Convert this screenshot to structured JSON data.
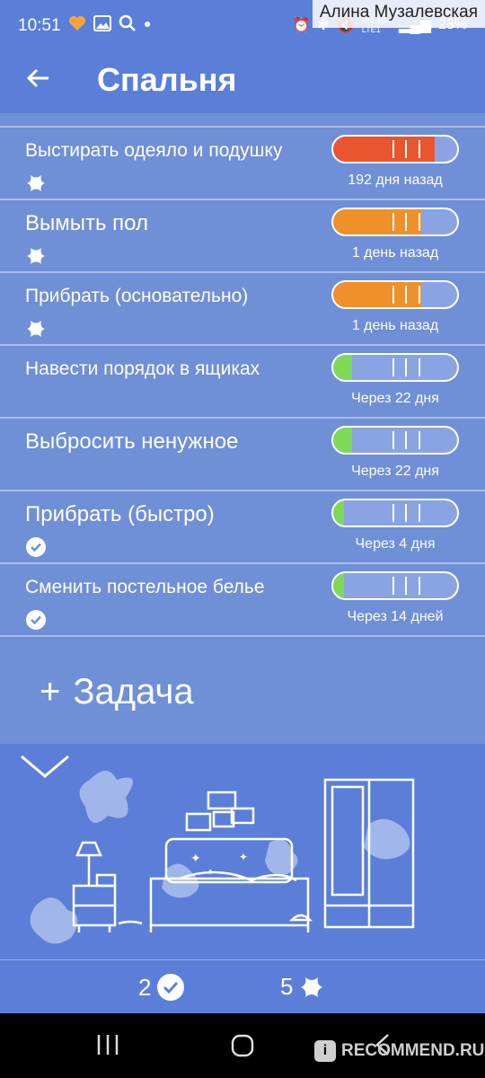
{
  "status": {
    "time": "10:51",
    "carrier": "Vo) 4G+\nLTE1",
    "battery": "23%",
    "watermark": "Алина Музалевская"
  },
  "header": {
    "title": "Спальня"
  },
  "tasks": [
    {
      "name": "Выстирать одеяло и подушку",
      "when": "192 дня  назад",
      "progress": 0.82,
      "color": "#e8552e",
      "marker": "sparkle-icon"
    },
    {
      "name": "Вымыть пол",
      "when": "1 день  назад",
      "progress": 0.71,
      "color": "#f0902a",
      "marker": "sparkle-icon"
    },
    {
      "name": "Прибрать (основательно)",
      "when": "1 день  назад",
      "progress": 0.71,
      "color": "#f0902a",
      "marker": "sparkle-icon"
    },
    {
      "name": "Навести порядок в ящиках",
      "when": "Через 22 дня",
      "progress": 0.15,
      "color": "#7ed957",
      "marker": ""
    },
    {
      "name": "Выбросить ненужное",
      "when": "Через 22 дня",
      "progress": 0.15,
      "color": "#7ed957",
      "marker": ""
    },
    {
      "name": "Прибрать (быстро)",
      "when": "Через 4 дня",
      "progress": 0.09,
      "color": "#7ed957",
      "marker": "check-icon"
    },
    {
      "name": "Сменить постельное белье",
      "when": "Через 14 дней",
      "progress": 0.09,
      "color": "#7ed957",
      "marker": "check-icon"
    }
  ],
  "add_task": {
    "plus": "+",
    "label": "Задача"
  },
  "footer": {
    "done_count": "2",
    "dirty_count": "5"
  },
  "recommend": {
    "logo_letter": "i",
    "text": "RECOMMEND.RU"
  }
}
